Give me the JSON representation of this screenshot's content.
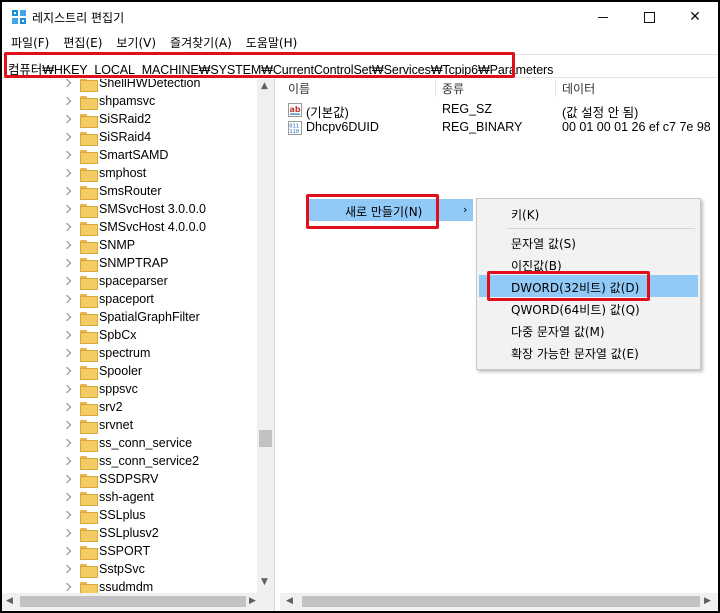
{
  "window": {
    "title": "레지스트리 편집기",
    "close_glyph": "✕"
  },
  "menu": [
    "파일(F)",
    "편집(E)",
    "보기(V)",
    "즐겨찾기(A)",
    "도움말(H)"
  ],
  "address": "컴퓨터₩HKEY_LOCAL_MACHINE₩SYSTEM₩CurrentControlSet₩Services₩Tcpip6₩Parameters",
  "tree": [
    "ShellHWDetection",
    "shpamsvc",
    "SiSRaid2",
    "SiSRaid4",
    "SmartSAMD",
    "smphost",
    "SmsRouter",
    "SMSvcHost 3.0.0.0",
    "SMSvcHost 4.0.0.0",
    "SNMP",
    "SNMPTRAP",
    "spaceparser",
    "spaceport",
    "SpatialGraphFilter",
    "SpbCx",
    "spectrum",
    "Spooler",
    "sppsvc",
    "srv2",
    "srvnet",
    "ss_conn_service",
    "ss_conn_service2",
    "SSDPSRV",
    "ssh-agent",
    "SSLplus",
    "SSLplusv2",
    "SSPORT",
    "SstpSvc",
    "ssudmdm"
  ],
  "columns": {
    "name": "이름",
    "type": "종류",
    "data": "데이터"
  },
  "values": [
    {
      "name": "(기본값)",
      "type": "REG_SZ",
      "data": "(값 설정 안 됨)",
      "icon": "string-value-icon"
    },
    {
      "name": "Dhcpv6DUID",
      "type": "REG_BINARY",
      "data": "00 01 00 01 26 ef c7 7e 98",
      "icon": "binary-value-icon"
    }
  ],
  "context_menu": {
    "new_label": "새로 만들기(N)",
    "submenu_arrow": "›",
    "items": {
      "key": "키(K)",
      "string": "문자열 값(S)",
      "binary": "이진값(B)",
      "dword": "DWORD(32비트) 값(D)",
      "qword": "QWORD(64비트) 값(Q)",
      "multi_string": "다중 문자열 값(M)",
      "expandable_string": "확장 가능한 문자열 값(E)"
    }
  },
  "colors": {
    "highlight": "#91c9f7",
    "callout": "#e0101a",
    "folder": "#f2cb62"
  }
}
